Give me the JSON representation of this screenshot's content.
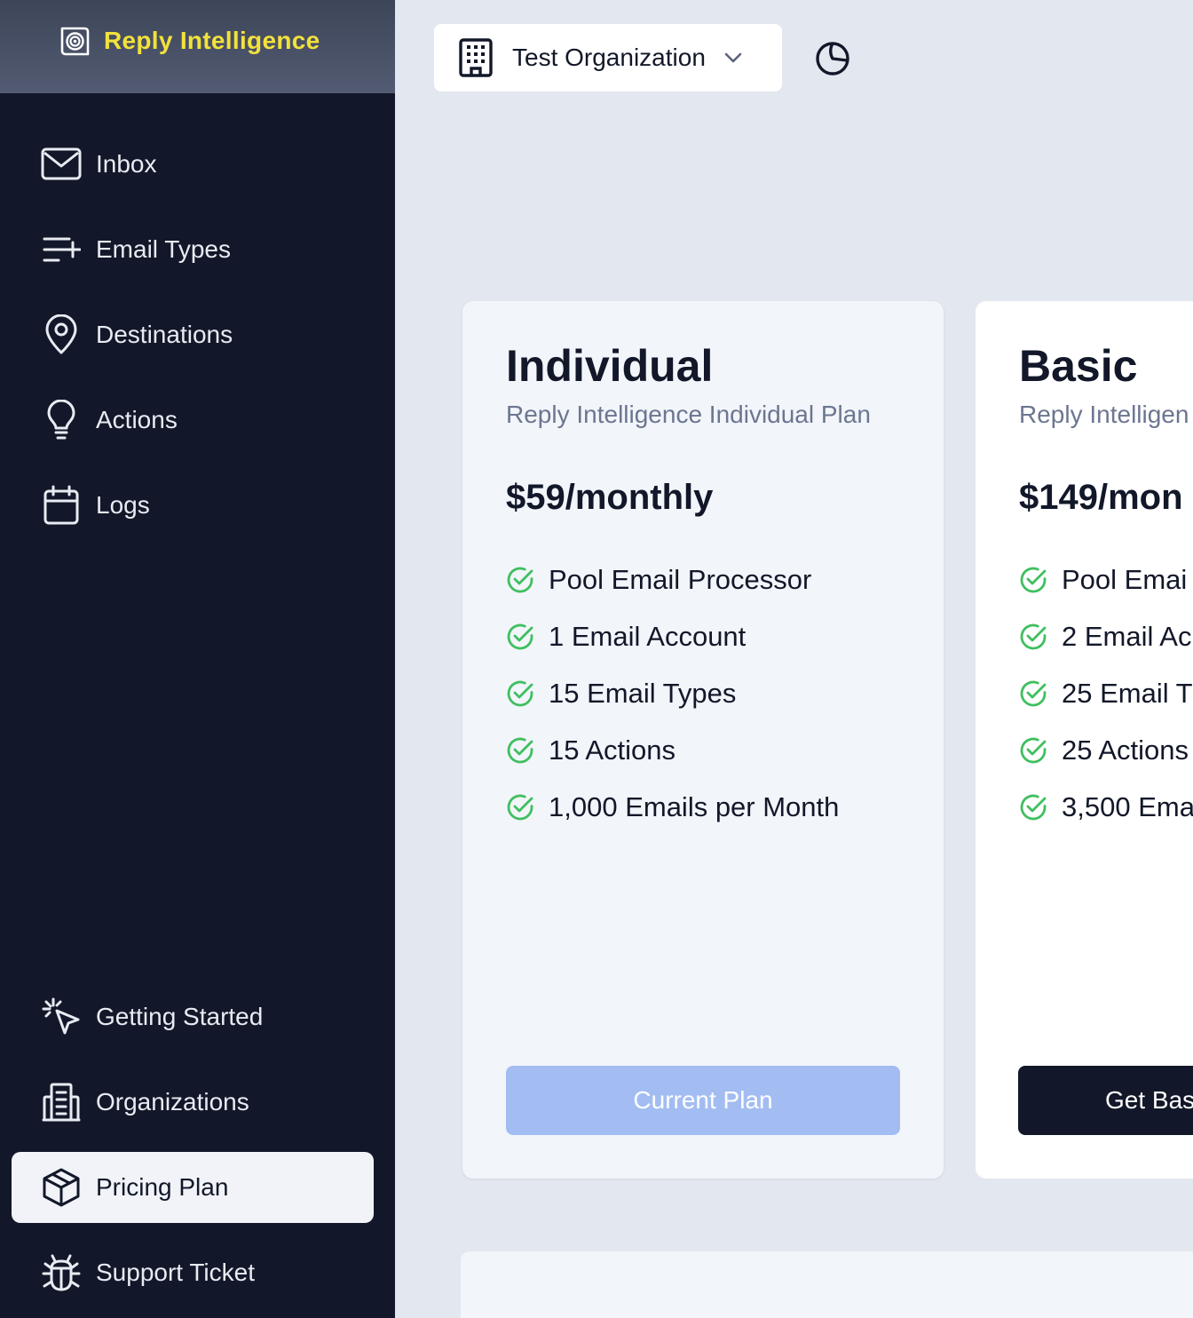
{
  "app": {
    "name": "Reply Intelligence"
  },
  "sidebar": {
    "items": [
      {
        "label": "Inbox",
        "icon": "mail-icon"
      },
      {
        "label": "Email Types",
        "icon": "list-plus-icon"
      },
      {
        "label": "Destinations",
        "icon": "map-pin-icon"
      },
      {
        "label": "Actions",
        "icon": "lightbulb-icon"
      },
      {
        "label": "Logs",
        "icon": "calendar-icon"
      }
    ],
    "bottom_items": [
      {
        "label": "Getting Started",
        "icon": "cursor-click-icon"
      },
      {
        "label": "Organizations",
        "icon": "building-icon"
      },
      {
        "label": "Pricing Plan",
        "icon": "package-icon",
        "active": true
      },
      {
        "label": "Support Ticket",
        "icon": "bug-icon"
      }
    ]
  },
  "topbar": {
    "organization": "Test Organization",
    "org_icon": "building-icon",
    "theme_icon": "half-moon-icon"
  },
  "plans": [
    {
      "name": "Individual",
      "description": "Reply Intelligence Individual Plan",
      "price": "$59/monthly",
      "features": [
        "Pool Email Processor",
        "1 Email Account",
        "15 Email Types",
        "15 Actions",
        "1,000 Emails per Month"
      ],
      "button": "Current Plan",
      "current": true
    },
    {
      "name": "Basic",
      "description": "Reply Intelligen",
      "price": "$149/mon",
      "features": [
        "Pool Emai",
        "2 Email Ac",
        "25 Email T",
        "25 Actions",
        "3,500 Ema"
      ],
      "button": "Get Bas",
      "current": false
    }
  ],
  "colors": {
    "sidebar_bg": "#121829",
    "brand_yellow": "#f2e13d",
    "check_green": "#3fbf5f",
    "current_plan_btn": "#a3bdf2",
    "primary_btn": "#121829"
  }
}
